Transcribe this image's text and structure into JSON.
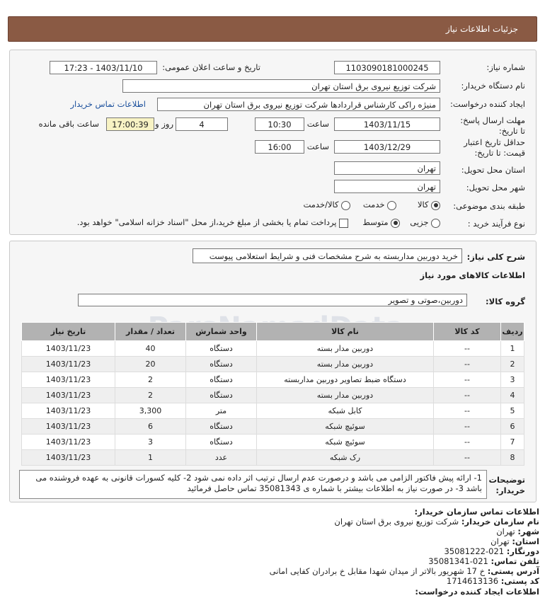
{
  "header": {
    "title": "جزئیات اطلاعات نیاز"
  },
  "form": {
    "need_number_label": "شماره نیاز:",
    "need_number": "1103090181000245",
    "announce_label": "تاریخ و ساعت اعلان عمومی:",
    "announce_value": "1403/11/10 - 17:23",
    "buyer_label": "نام دستگاه خریدار:",
    "buyer_value": "شرکت توزیع نیروی برق استان تهران",
    "creator_label": "ایجاد کننده درخواست:",
    "creator_value": "منیژه راکی کارشناس قراردادها شرکت توزیع نیروی برق استان تهران",
    "contact_link": "اطلاعات تماس خریدار",
    "deadline_label": "مهلت ارسال پاسخ: تا تاریخ:",
    "deadline_date": "1403/11/15",
    "time_label": "ساعت",
    "deadline_time": "10:30",
    "days_value": "4",
    "days_label": "روز و",
    "remaining_time": "17:00:39",
    "remaining_label": "ساعت باقی مانده",
    "validity_label": "حداقل تاریخ اعتبار قیمت: تا تاریخ:",
    "validity_date": "1403/12/29",
    "validity_time": "16:00",
    "province_label": "استان محل تحویل:",
    "province_value": "تهران",
    "city_label": "شهر محل تحویل:",
    "city_value": "تهران",
    "category_label": "طبقه بندی موضوعی:",
    "category_options": [
      "کالا",
      "خدمت",
      "کالا/خدمت"
    ],
    "purchase_type_label": "نوع فرآیند خرید :",
    "purchase_options": [
      "جزیی",
      "متوسط"
    ],
    "payment_note": "پرداخت تمام یا بخشی از مبلغ خرید،از محل \"اسناد خزانه اسلامی\" خواهد بود."
  },
  "summary": {
    "desc_label": "شرح کلی نیاز:",
    "desc_value": "خرید دوربین مداربسته به شرح مشخصات فنی و شرایط استعلامی پیوست",
    "goods_info_title": "اطلاعات کالاهای مورد نیاز",
    "group_label": "گروه کالا:",
    "group_value": "دوربین،صوتی و تصویر"
  },
  "table": {
    "headers": [
      "ردیف",
      "کد کالا",
      "نام کالا",
      "واحد شمارش",
      "تعداد / مقدار",
      "تاریخ نیاز"
    ],
    "rows": [
      [
        "1",
        "--",
        "دوربین مدار بسته",
        "دستگاه",
        "40",
        "1403/11/23"
      ],
      [
        "2",
        "--",
        "دوربین مدار بسته",
        "دستگاه",
        "20",
        "1403/11/23"
      ],
      [
        "3",
        "--",
        "دستگاه ضبط تصاویر دوربین مداربسته",
        "دستگاه",
        "2",
        "1403/11/23"
      ],
      [
        "4",
        "--",
        "دوربین مدار بسته",
        "دستگاه",
        "2",
        "1403/11/23"
      ],
      [
        "5",
        "--",
        "کابل شبکه",
        "متر",
        "3,300",
        "1403/11/23"
      ],
      [
        "6",
        "--",
        "سوئیچ شبکه",
        "دستگاه",
        "6",
        "1403/11/23"
      ],
      [
        "7",
        "--",
        "سوئیچ شبکه",
        "دستگاه",
        "3",
        "1403/11/23"
      ],
      [
        "8",
        "--",
        "رک شبکه",
        "عدد",
        "1",
        "1403/11/23"
      ]
    ]
  },
  "notes": {
    "label": "توضیحات خریدار:",
    "text": "1- ارائه پیش فاکتور الزامی می باشد و درصورت عدم ارسال ترتیب اثر داده نمی شود 2- کلیه کسورات قانونی به عهده فروشنده می باشد 3- در صورت نیاز به اطلاعات بیشتر با شماره ی 35081343 تماس حاصل فرمائید"
  },
  "contact": {
    "title": "اطلاعات تماس سازمان خریدار:",
    "org_label": "نام سازمان خریدار:",
    "org_value": "شرکت توزیع نیروی برق استان تهران",
    "city_label": "شهر:",
    "city_value": "تهران",
    "province_label": "استان:",
    "province_value": "تهران",
    "fax_label": "دورنگار:",
    "fax_value": "021-35081222",
    "phone_label": "تلفن تماس:",
    "phone_value": "021-35081341",
    "address_label": "آدرس پستی:",
    "address_value": "خ 17 شهریور بالاتر از میدان شهدا مقابل خ برادران کفایی امانی",
    "postal_label": "کد پستی:",
    "postal_value": "1714613136",
    "creator_info_label": "اطلاعات ایجاد کننده درخواست:"
  },
  "watermark": {
    "text": "ParsNamadData"
  }
}
